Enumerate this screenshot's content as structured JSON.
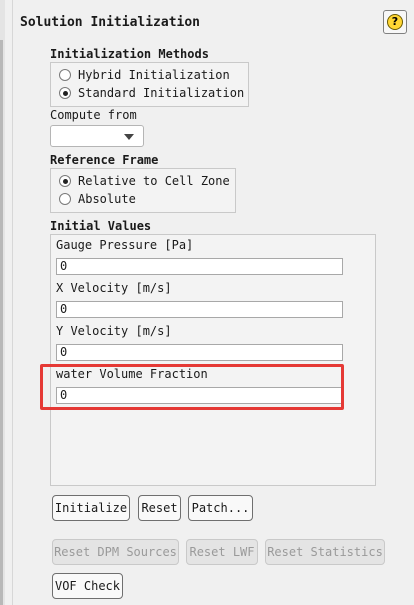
{
  "panel": {
    "title": "Solution Initialization",
    "help_glyph": "?"
  },
  "init_methods": {
    "heading": "Initialization Methods",
    "options": [
      "Hybrid  Initialization",
      "Standard Initialization"
    ],
    "selected": "Standard Initialization"
  },
  "compute_from": {
    "label": "Compute from",
    "value": ""
  },
  "reference_frame": {
    "heading": "Reference Frame",
    "options": [
      "Relative to Cell Zone",
      "Absolute"
    ],
    "selected": "Relative to Cell Zone"
  },
  "initial_values": {
    "heading": "Initial Values",
    "fields": [
      {
        "label": "Gauge Pressure [Pa]",
        "value": "0"
      },
      {
        "label": "X Velocity [m/s]",
        "value": "0"
      },
      {
        "label": "Y Velocity [m/s]",
        "value": "0"
      },
      {
        "label": "water Volume Fraction",
        "value": "0"
      }
    ]
  },
  "buttons": {
    "initialize": "Initialize",
    "reset": "Reset",
    "patch": "Patch...",
    "reset_dpm": "Reset DPM Sources",
    "reset_lwf": "Reset LWF",
    "reset_statistics": "Reset Statistics",
    "vof_check": "VOF Check"
  },
  "colors": {
    "highlight": "#e53935",
    "help_icon": "#ffd633"
  }
}
